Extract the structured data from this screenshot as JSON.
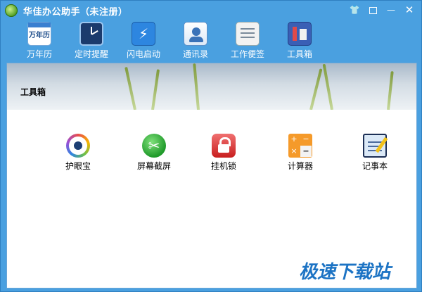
{
  "window": {
    "title": "华佳办公助手（未注册）",
    "controls": {
      "skin": "👕",
      "close": "✕"
    }
  },
  "toolbar": {
    "items": [
      {
        "label": "万年历",
        "icon": "calendar-icon",
        "badge": "万年历"
      },
      {
        "label": "定时提醒",
        "icon": "clock-icon"
      },
      {
        "label": "闪电启动",
        "icon": "flash-icon",
        "glyph": "⚡"
      },
      {
        "label": "通讯录",
        "icon": "contacts-icon"
      },
      {
        "label": "工作便签",
        "icon": "sticky-note-icon"
      },
      {
        "label": "工具箱",
        "icon": "toolbox-icon"
      }
    ]
  },
  "main": {
    "section_title": "工具箱",
    "tools": [
      {
        "label": "护眼宝",
        "icon": "eye-care-icon"
      },
      {
        "label": "屏幕截屏",
        "icon": "scissors-icon",
        "glyph": "✂"
      },
      {
        "label": "挂机锁",
        "icon": "lock-icon"
      },
      {
        "label": "计算器",
        "icon": "calculator-icon",
        "keys": [
          "+",
          "−",
          "×",
          "="
        ]
      },
      {
        "label": "记事本",
        "icon": "notepad-icon"
      }
    ]
  },
  "watermark": "极速下载站",
  "colors": {
    "titlebar": "#4aa0e0",
    "watermark": "#1c73c4"
  }
}
